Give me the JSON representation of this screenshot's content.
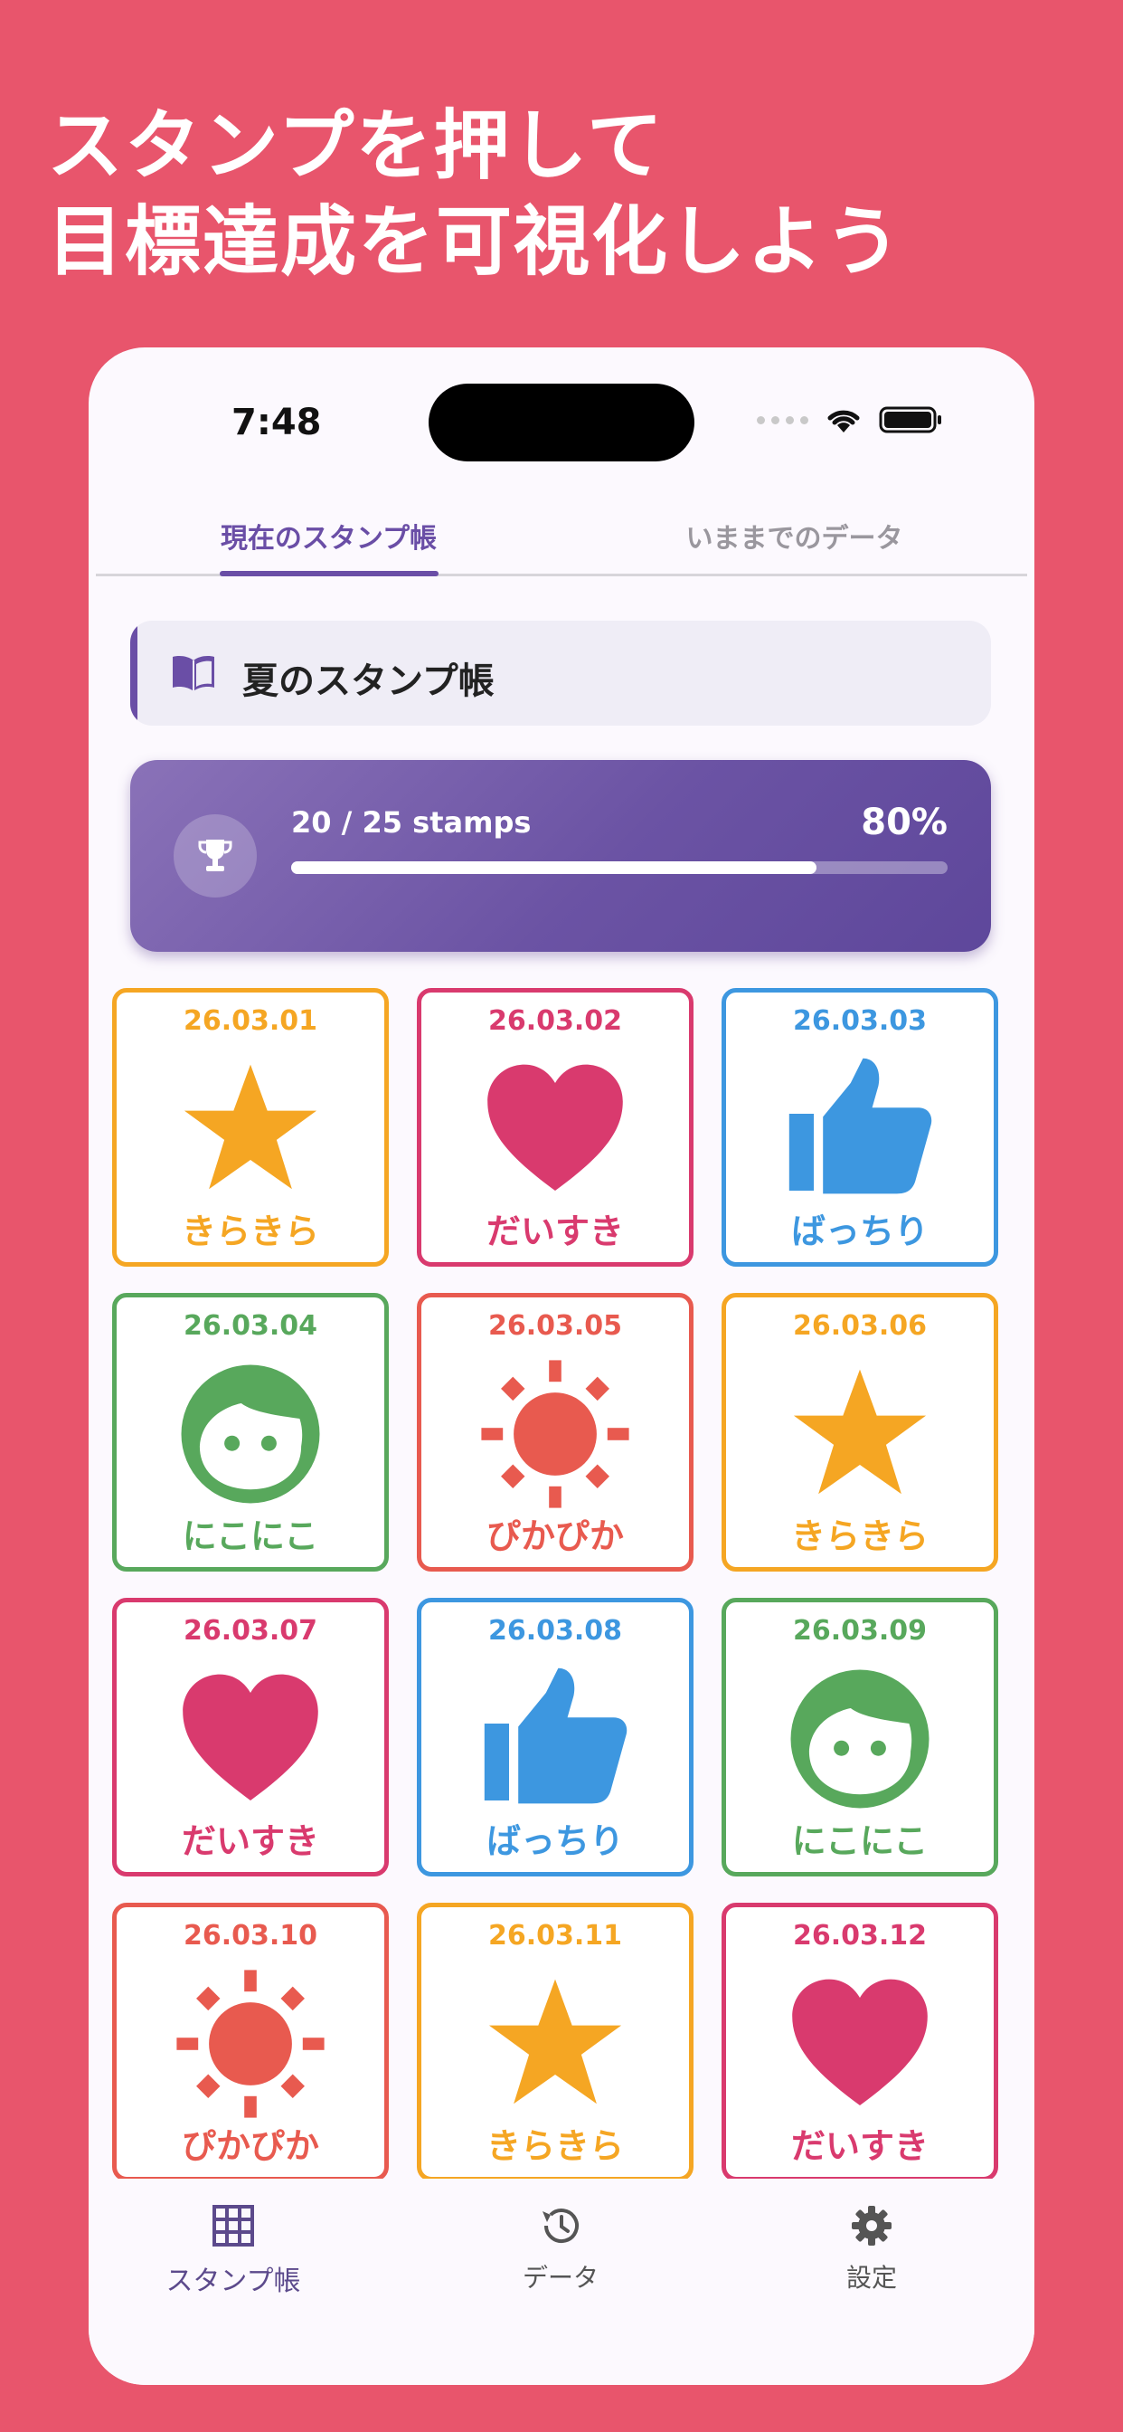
{
  "headline": {
    "line1": "スタンプを押して",
    "line2": "目標達成を可視化しよう"
  },
  "status_bar": {
    "time": "7:48"
  },
  "tabs": [
    {
      "label": "現在のスタンプ帳",
      "active": true
    },
    {
      "label": "いままでのデータ",
      "active": false
    }
  ],
  "book": {
    "title": "夏のスタンプ帳",
    "icon": "open-book-icon"
  },
  "progress": {
    "text": "20 / 25 stamps",
    "percent_label": "80%",
    "fraction": 0.8,
    "icon": "trophy-icon"
  },
  "colors": {
    "background": "#e8556c",
    "accent": "#6a4ea6",
    "orange": "#f5a623",
    "pink": "#d93a6e",
    "blue": "#3d97e0",
    "green": "#58a85c",
    "red": "#e85a4f"
  },
  "stamps": [
    {
      "date": "26.03.01",
      "label": "きらきら",
      "type": "star",
      "icon": "star-icon"
    },
    {
      "date": "26.03.02",
      "label": "だいすき",
      "type": "heart",
      "icon": "heart-icon"
    },
    {
      "date": "26.03.03",
      "label": "ばっちり",
      "type": "thumb",
      "icon": "thumbs-up-icon"
    },
    {
      "date": "26.03.04",
      "label": "にこにこ",
      "type": "face",
      "icon": "smile-face-icon"
    },
    {
      "date": "26.03.05",
      "label": "ぴかぴか",
      "type": "sun",
      "icon": "sun-icon"
    },
    {
      "date": "26.03.06",
      "label": "きらきら",
      "type": "star",
      "icon": "star-icon"
    },
    {
      "date": "26.03.07",
      "label": "だいすき",
      "type": "heart",
      "icon": "heart-icon"
    },
    {
      "date": "26.03.08",
      "label": "ばっちり",
      "type": "thumb",
      "icon": "thumbs-up-icon"
    },
    {
      "date": "26.03.09",
      "label": "にこにこ",
      "type": "face",
      "icon": "smile-face-icon"
    },
    {
      "date": "26.03.10",
      "label": "ぴかぴか",
      "type": "sun",
      "icon": "sun-icon"
    },
    {
      "date": "26.03.11",
      "label": "きらきら",
      "type": "star",
      "icon": "star-icon"
    },
    {
      "date": "26.03.12",
      "label": "だいすき",
      "type": "heart",
      "icon": "heart-icon"
    }
  ],
  "bottom_nav": [
    {
      "label": "スタンプ帳",
      "icon": "grid-icon",
      "active": true
    },
    {
      "label": "データ",
      "icon": "history-icon",
      "active": false
    },
    {
      "label": "設定",
      "icon": "gear-icon",
      "active": false
    }
  ]
}
